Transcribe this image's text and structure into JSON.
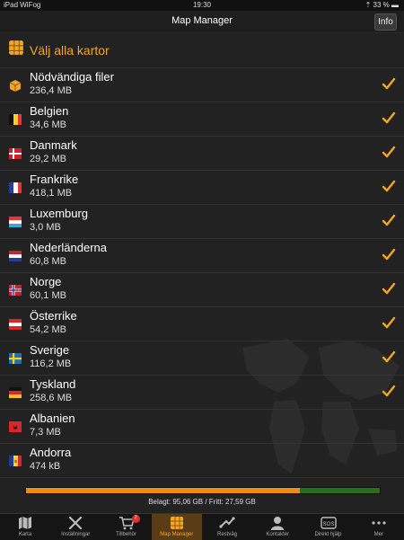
{
  "status_bar": {
    "carrier": "iPad",
    "network": "WiFog",
    "time": "19:30",
    "battery": "33 %"
  },
  "nav": {
    "title": "Map Manager",
    "info_label": "Info"
  },
  "select_all": {
    "label": "Välj alla kartor"
  },
  "maps": [
    {
      "name": "Nödvändiga filer",
      "size": "236,4 MB",
      "checked": true,
      "flag": "box"
    },
    {
      "name": "Belgien",
      "size": "34,6 MB",
      "checked": true,
      "flag": "be"
    },
    {
      "name": "Danmark",
      "size": "29,2 MB",
      "checked": true,
      "flag": "dk"
    },
    {
      "name": "Frankrike",
      "size": "418,1 MB",
      "checked": true,
      "flag": "fr"
    },
    {
      "name": "Luxemburg",
      "size": "3,0 MB",
      "checked": true,
      "flag": "lu"
    },
    {
      "name": "Nederländerna",
      "size": "60,8 MB",
      "checked": true,
      "flag": "nl"
    },
    {
      "name": "Norge",
      "size": "60,1 MB",
      "checked": true,
      "flag": "no"
    },
    {
      "name": "Österrike",
      "size": "54,2 MB",
      "checked": true,
      "flag": "at"
    },
    {
      "name": "Sverige",
      "size": "116,2 MB",
      "checked": true,
      "flag": "se"
    },
    {
      "name": "Tyskland",
      "size": "258,6 MB",
      "checked": true,
      "flag": "de"
    },
    {
      "name": "Albanien",
      "size": "7,3 MB",
      "checked": false,
      "flag": "al"
    },
    {
      "name": "Andorra",
      "size": "474 kB",
      "checked": false,
      "flag": "ad"
    }
  ],
  "storage": {
    "label": "Belagt: 95,06 GB / Fritt: 27,59 GB",
    "used_fraction": 0.775
  },
  "tabs": [
    {
      "label": "Karta",
      "icon": "map-icon",
      "active": false
    },
    {
      "label": "Inställningar",
      "icon": "tools-icon",
      "active": false
    },
    {
      "label": "Tillbehör",
      "icon": "cart-icon",
      "active": false,
      "badge": "7"
    },
    {
      "label": "Map Manager",
      "icon": "map-manager-icon",
      "active": true
    },
    {
      "label": "Restväg",
      "icon": "route-icon",
      "active": false
    },
    {
      "label": "Kontakter",
      "icon": "contact-icon",
      "active": false
    },
    {
      "label": "Direkt hjälp",
      "icon": "sos-icon",
      "active": false
    },
    {
      "label": "Mer",
      "icon": "more-icon",
      "active": false
    }
  ],
  "colors": {
    "accent": "#f5a623",
    "bar_used": "#f08c14",
    "bar_free": "#2f6b1e"
  }
}
